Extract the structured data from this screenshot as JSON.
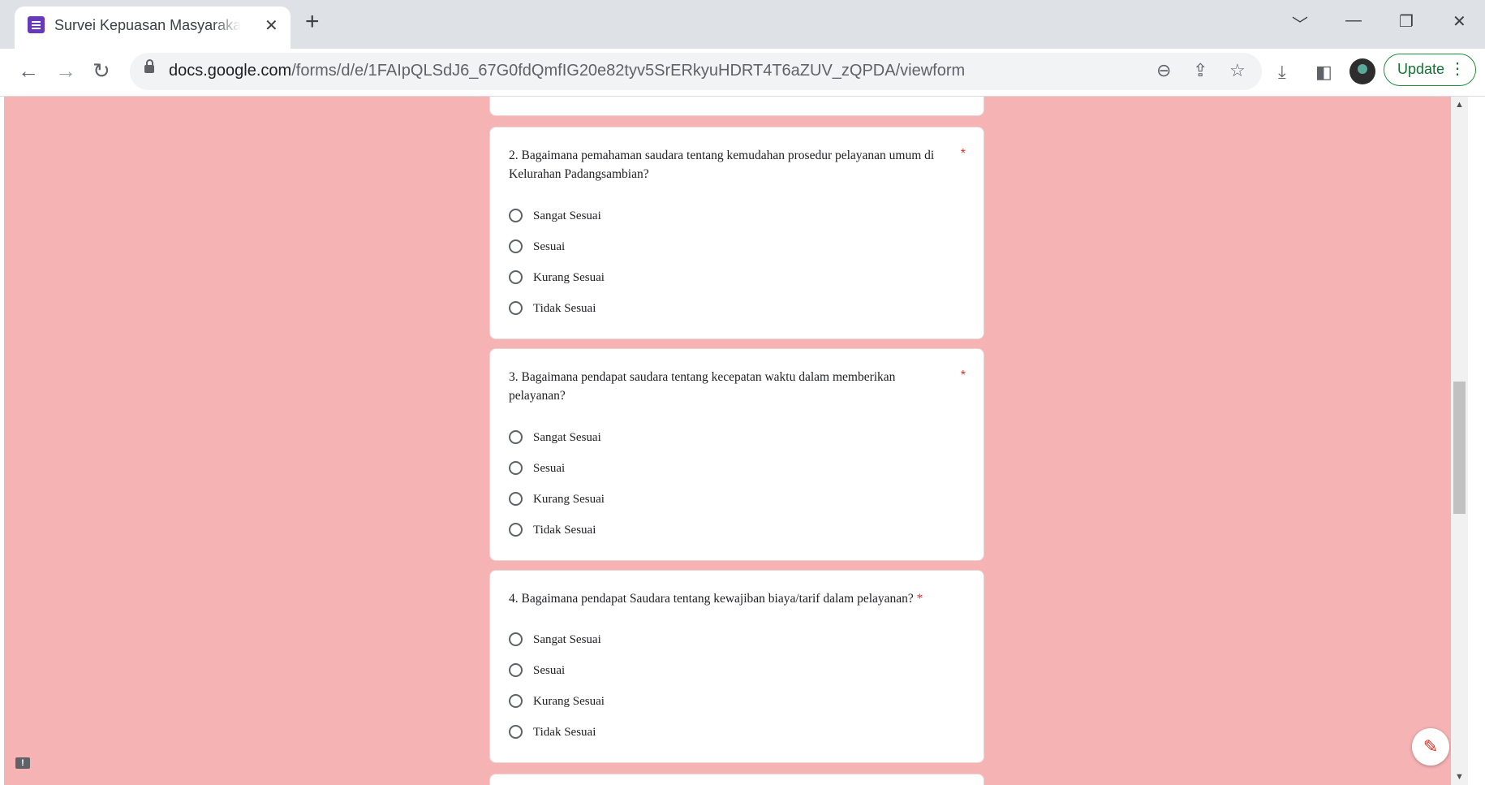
{
  "browser": {
    "tab_title": "Survei Kepuasan Masyarakat (SKM",
    "tab_close": "✕",
    "new_tab": "+",
    "url_host": "docs.google.com",
    "url_path": "/forms/d/e/1FAIpQLSdJ6_67G0fdQmfIG20e82tyv5SrERkyuHDRT4T6aZUV_zQPDA/viewform",
    "update_label": "Update",
    "accent_color": "#1e8e3e"
  },
  "form": {
    "background_color": "#f6b3b4",
    "required_mark": "*",
    "questions": [
      {
        "title": "2. Bagaimana pemahaman saudara tentang kemudahan prosedur pelayanan umum di Kelurahan Padangsambian?",
        "options": [
          "Sangat Sesuai",
          "Sesuai",
          "Kurang Sesuai",
          "Tidak Sesuai"
        ]
      },
      {
        "title": "3. Bagaimana pendapat saudara tentang kecepatan  waktu dalam memberikan pelayanan?",
        "options": [
          "Sangat Sesuai",
          "Sesuai",
          "Kurang Sesuai",
          "Tidak Sesuai"
        ]
      },
      {
        "title": "4. Bagaimana pendapat Saudara tentang kewajiban biaya/tarif dalam pelayanan?",
        "options": [
          "Sangat Sesuai",
          "Sesuai",
          "Kurang Sesuai",
          "Tidak Sesuai"
        ]
      }
    ]
  }
}
